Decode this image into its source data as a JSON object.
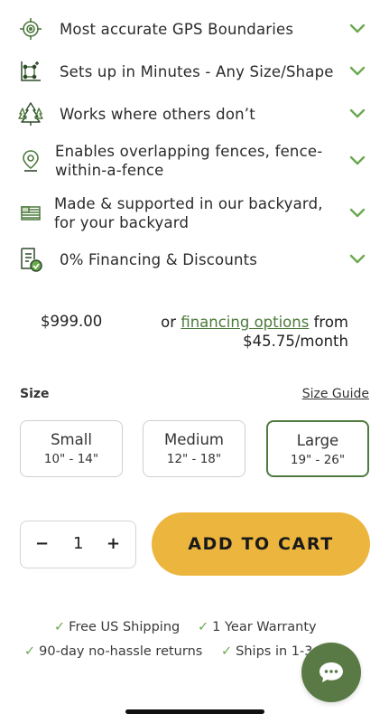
{
  "features": [
    {
      "icon": "gps-target-icon",
      "label": "Most accurate GPS Boundaries"
    },
    {
      "icon": "boundary-map-icon",
      "label": "Sets up in Minutes - Any Size/Shape"
    },
    {
      "icon": "trees-icon",
      "label": "Works where others don’t"
    },
    {
      "icon": "map-pin-icon",
      "label": "Enables overlapping fences, fence-within-a-fence"
    },
    {
      "icon": "flag-icon",
      "label": "Made & supported in our backyard, for your backyard"
    },
    {
      "icon": "document-check-icon",
      "label": "0% Financing & Discounts"
    }
  ],
  "pricing": {
    "price": "$999.00",
    "financing_prefix": "or",
    "financing_link": "financing options",
    "financing_suffix": "from $45.75/month"
  },
  "size": {
    "title": "Size",
    "guide_label": "Size Guide",
    "options": [
      {
        "name": "Small",
        "range": "10\" - 14\""
      },
      {
        "name": "Medium",
        "range": "12\" - 18\""
      },
      {
        "name": "Large",
        "range": "19\" - 26\""
      }
    ],
    "selected": "Large"
  },
  "quantity": {
    "minus": "−",
    "value": "1",
    "plus": "+"
  },
  "cart": {
    "label": "ADD TO CART"
  },
  "perks": [
    "Free US Shipping",
    "1 Year Warranty",
    "90-day no-hassle returns",
    "Ships in 1-3"
  ],
  "colors": {
    "accent_green": "#4e7a3f",
    "check_green": "#6aa84f",
    "cart_yellow": "#ecb53e",
    "chat_green": "#5a7a45"
  }
}
